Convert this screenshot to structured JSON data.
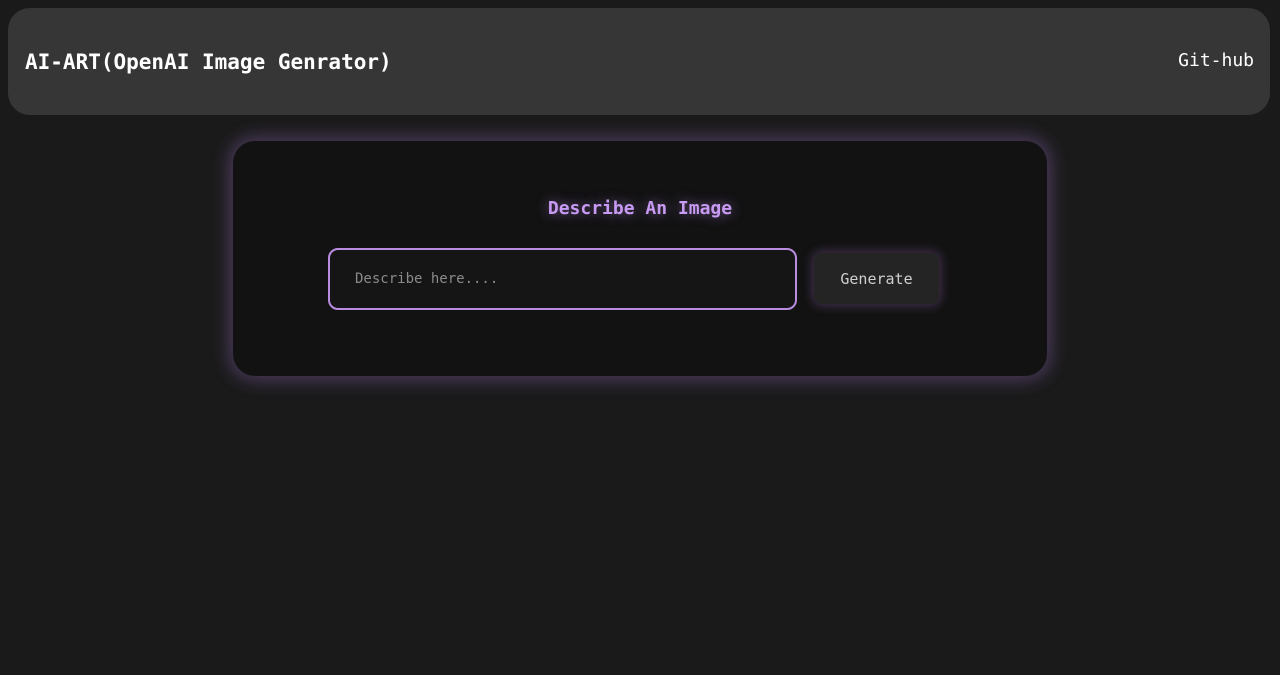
{
  "navbar": {
    "brand": "AI-ART(OpenAI Image Genrator)",
    "link_label": "Git-hub"
  },
  "main": {
    "title": "Describe An Image",
    "input": {
      "value": "",
      "placeholder": "Describe here...."
    },
    "generate_label": "Generate"
  },
  "colors": {
    "background": "#1a1a1a",
    "navbar": "#363636",
    "card": "#121212",
    "accent": "#c79af3",
    "input_border": "#b98cdf"
  }
}
